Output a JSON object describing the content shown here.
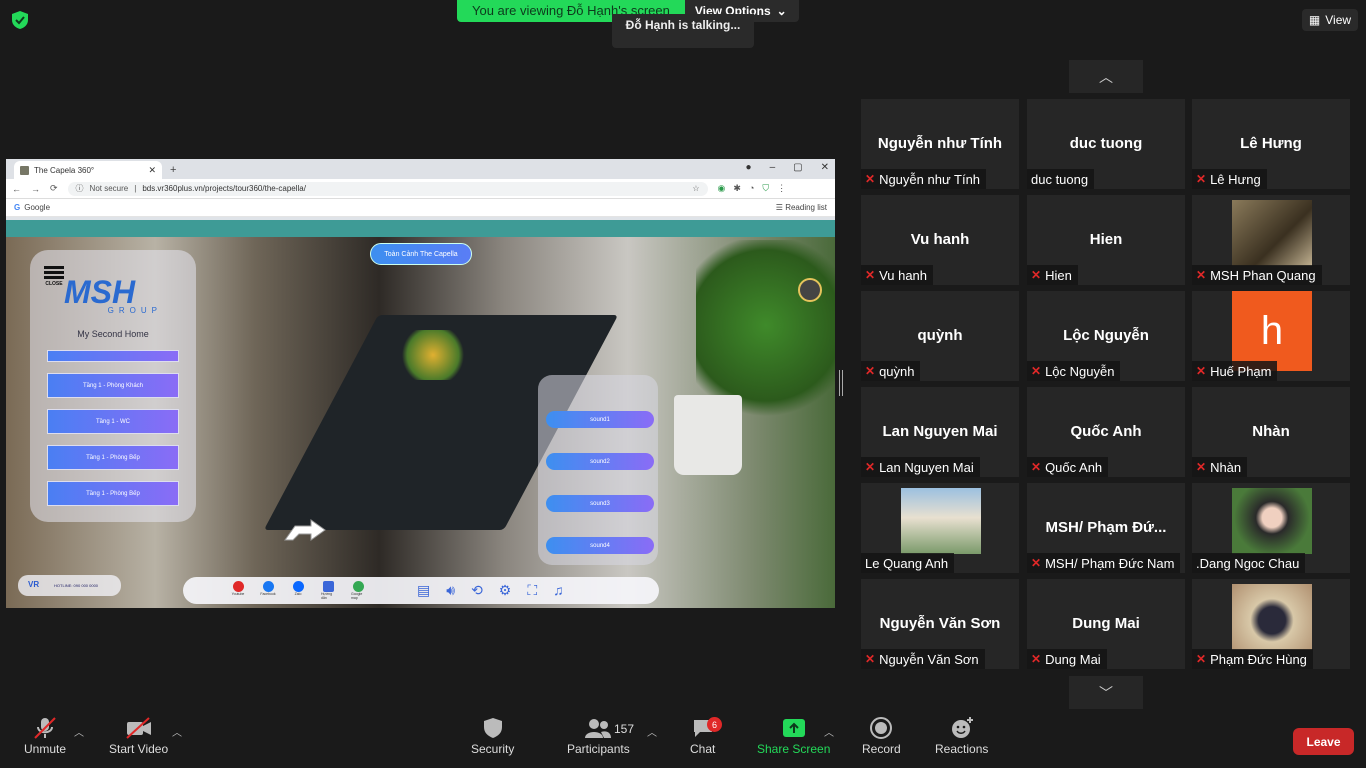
{
  "topbar": {
    "viewing": "You are viewing Đỗ Hạnh's screen",
    "view_options": "View Options",
    "talking": "Đỗ Hạnh is talking...",
    "view": "View"
  },
  "browser": {
    "tab_title": "The Capela 360°",
    "url_prefix": "Not secure",
    "url": "bds.vr360plus.vn/projects/tour360/the-capella/",
    "bookmark": "Google",
    "reading_list": "Reading list"
  },
  "tour": {
    "top_button": "Toàn Cảnh The Capella",
    "close": "CLOSE",
    "logo": "MSH",
    "logo_sub": "GROUP",
    "slogan": "My Second Home",
    "menu": [
      "Tầng 1 - Phòng Khách",
      "Tầng 1 - WC",
      "Tầng 1 - Phòng Bếp",
      "Tầng 1 - Phòng Bếp"
    ],
    "sounds": [
      "sound1",
      "sound2",
      "sound3",
      "sound4"
    ],
    "social": [
      "Youtube",
      "Facebook",
      "Zalo",
      "Hướng dẫn",
      "Google map"
    ],
    "contact_logo": "VR",
    "contact": "HOTLINE: 090 000 0000"
  },
  "participants": [
    {
      "big": "Nguyễn như Tính",
      "label": "Nguyễn như Tính",
      "muted": true
    },
    {
      "big": "duc tuong",
      "label": "duc tuong",
      "muted": false
    },
    {
      "big": "Lê Hưng",
      "label": "Lê Hưng",
      "muted": true
    },
    {
      "big": "Vu hanh",
      "label": "Vu hanh",
      "muted": true
    },
    {
      "big": "Hien",
      "label": "Hien",
      "muted": true
    },
    {
      "big": "",
      "label": "MSH Phan Quang",
      "muted": true,
      "video": "piano"
    },
    {
      "big": "quỳnh",
      "label": "quỳnh",
      "muted": true
    },
    {
      "big": "Lộc Nguyễn",
      "label": "Lộc Nguyễn",
      "muted": true
    },
    {
      "big": "",
      "label": "Huế Phạm",
      "muted": true,
      "letter": "h"
    },
    {
      "big": "Lan Nguyen Mai",
      "label": "Lan Nguyen Mai",
      "muted": true
    },
    {
      "big": "Quốc Anh",
      "label": "Quốc Anh",
      "muted": true
    },
    {
      "big": "Nhàn",
      "label": "Nhàn",
      "muted": true
    },
    {
      "big": "",
      "label": "Le Quang Anh",
      "muted": false,
      "video": "building"
    },
    {
      "big": "MSH/ Phạm Đứ...",
      "label": "MSH/ Phạm Đức Nam",
      "muted": true
    },
    {
      "big": "",
      "label": ".Dang Ngoc Chau",
      "muted": false,
      "video": "woman"
    },
    {
      "big": "Nguyễn Văn Sơn",
      "label": "Nguyễn Văn Sơn",
      "muted": true
    },
    {
      "big": "Dung Mai",
      "label": "Dung Mai",
      "muted": true
    },
    {
      "big": "",
      "label": "Phạm Đức Hùng",
      "muted": true,
      "video": "man"
    }
  ],
  "controls": {
    "unmute": "Unmute",
    "start_video": "Start Video",
    "security": "Security",
    "participants": "Participants",
    "participant_count": "157",
    "chat": "Chat",
    "chat_badge": "6",
    "share_screen": "Share Screen",
    "record": "Record",
    "reactions": "Reactions",
    "leave": "Leave"
  },
  "colors": {
    "accent_green": "#23d959",
    "leave_red": "#c82828",
    "share_green": "#23d959"
  }
}
